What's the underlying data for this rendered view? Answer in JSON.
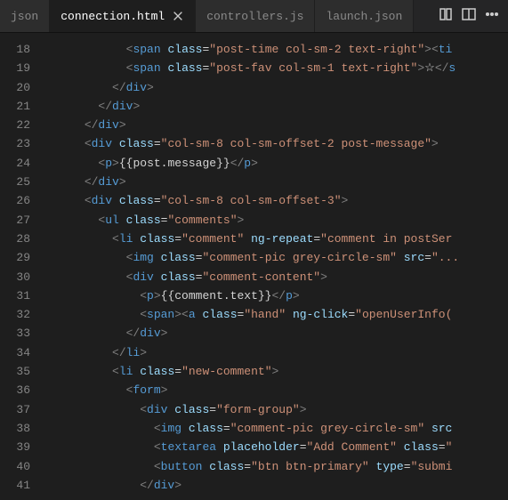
{
  "tabs": {
    "t0": "json",
    "t1": "connection.html",
    "t2": "controllers.js",
    "t3": "launch.json"
  },
  "gutter": [
    "18",
    "19",
    "20",
    "21",
    "22",
    "23",
    "24",
    "25",
    "26",
    "27",
    "28",
    "29",
    "30",
    "31",
    "32",
    "33",
    "34",
    "35",
    "36",
    "37",
    "38",
    "39",
    "40",
    "41"
  ],
  "code": {
    "l18": [
      {
        "c": "t-txt",
        "t": "            "
      },
      {
        "c": "t-brk",
        "t": "<"
      },
      {
        "c": "t-tag",
        "t": "span"
      },
      {
        "c": "t-txt",
        "t": " "
      },
      {
        "c": "t-attr",
        "t": "class"
      },
      {
        "c": "t-txt",
        "t": "="
      },
      {
        "c": "t-str",
        "t": "\"post-time col-sm-2 text-right\""
      },
      {
        "c": "t-brk",
        "t": "><"
      },
      {
        "c": "t-tag",
        "t": "ti"
      }
    ],
    "l19": [
      {
        "c": "t-txt",
        "t": "            "
      },
      {
        "c": "t-brk",
        "t": "<"
      },
      {
        "c": "t-tag",
        "t": "span"
      },
      {
        "c": "t-txt",
        "t": " "
      },
      {
        "c": "t-attr",
        "t": "class"
      },
      {
        "c": "t-txt",
        "t": "="
      },
      {
        "c": "t-str",
        "t": "\"post-fav col-sm-1 text-right\""
      },
      {
        "c": "t-brk",
        "t": ">"
      },
      {
        "c": "t-txt",
        "t": "☆"
      },
      {
        "c": "t-brk",
        "t": "</"
      },
      {
        "c": "t-tag",
        "t": "s"
      }
    ],
    "l20": [
      {
        "c": "t-txt",
        "t": "          "
      },
      {
        "c": "t-brk",
        "t": "</"
      },
      {
        "c": "t-tag",
        "t": "div"
      },
      {
        "c": "t-brk",
        "t": ">"
      }
    ],
    "l21": [
      {
        "c": "t-txt",
        "t": "        "
      },
      {
        "c": "t-brk",
        "t": "</"
      },
      {
        "c": "t-tag",
        "t": "div"
      },
      {
        "c": "t-brk",
        "t": ">"
      }
    ],
    "l22": [
      {
        "c": "t-txt",
        "t": "      "
      },
      {
        "c": "t-brk",
        "t": "</"
      },
      {
        "c": "t-tag",
        "t": "div"
      },
      {
        "c": "t-brk",
        "t": ">"
      }
    ],
    "l23": [
      {
        "c": "t-txt",
        "t": "      "
      },
      {
        "c": "t-brk",
        "t": "<"
      },
      {
        "c": "t-tag",
        "t": "div"
      },
      {
        "c": "t-txt",
        "t": " "
      },
      {
        "c": "t-attr",
        "t": "class"
      },
      {
        "c": "t-txt",
        "t": "="
      },
      {
        "c": "t-str",
        "t": "\"col-sm-8 col-sm-offset-2 post-message\""
      },
      {
        "c": "t-brk",
        "t": ">"
      }
    ],
    "l24": [
      {
        "c": "t-txt",
        "t": "        "
      },
      {
        "c": "t-brk",
        "t": "<"
      },
      {
        "c": "t-tag",
        "t": "p"
      },
      {
        "c": "t-brk",
        "t": ">"
      },
      {
        "c": "t-txt",
        "t": "{{post.message}}"
      },
      {
        "c": "t-brk",
        "t": "</"
      },
      {
        "c": "t-tag",
        "t": "p"
      },
      {
        "c": "t-brk",
        "t": ">"
      }
    ],
    "l25": [
      {
        "c": "t-txt",
        "t": "      "
      },
      {
        "c": "t-brk",
        "t": "</"
      },
      {
        "c": "t-tag",
        "t": "div"
      },
      {
        "c": "t-brk",
        "t": ">"
      }
    ],
    "l26": [
      {
        "c": "t-txt",
        "t": "      "
      },
      {
        "c": "t-brk",
        "t": "<"
      },
      {
        "c": "t-tag",
        "t": "div"
      },
      {
        "c": "t-txt",
        "t": " "
      },
      {
        "c": "t-attr",
        "t": "class"
      },
      {
        "c": "t-txt",
        "t": "="
      },
      {
        "c": "t-str",
        "t": "\"col-sm-8 col-sm-offset-3\""
      },
      {
        "c": "t-brk",
        "t": ">"
      }
    ],
    "l27": [
      {
        "c": "t-txt",
        "t": "        "
      },
      {
        "c": "t-brk",
        "t": "<"
      },
      {
        "c": "t-tag",
        "t": "ul"
      },
      {
        "c": "t-txt",
        "t": " "
      },
      {
        "c": "t-attr",
        "t": "class"
      },
      {
        "c": "t-txt",
        "t": "="
      },
      {
        "c": "t-str",
        "t": "\"comments\""
      },
      {
        "c": "t-brk",
        "t": ">"
      }
    ],
    "l28": [
      {
        "c": "t-txt",
        "t": "          "
      },
      {
        "c": "t-brk",
        "t": "<"
      },
      {
        "c": "t-tag",
        "t": "li"
      },
      {
        "c": "t-txt",
        "t": " "
      },
      {
        "c": "t-attr",
        "t": "class"
      },
      {
        "c": "t-txt",
        "t": "="
      },
      {
        "c": "t-str",
        "t": "\"comment\""
      },
      {
        "c": "t-txt",
        "t": " "
      },
      {
        "c": "t-attr",
        "t": "ng-repeat"
      },
      {
        "c": "t-txt",
        "t": "="
      },
      {
        "c": "t-str",
        "t": "\"comment in postSer"
      }
    ],
    "l29": [
      {
        "c": "t-txt",
        "t": "            "
      },
      {
        "c": "t-brk",
        "t": "<"
      },
      {
        "c": "t-tag",
        "t": "img"
      },
      {
        "c": "t-txt",
        "t": " "
      },
      {
        "c": "t-attr",
        "t": "class"
      },
      {
        "c": "t-txt",
        "t": "="
      },
      {
        "c": "t-str",
        "t": "\"comment-pic grey-circle-sm\""
      },
      {
        "c": "t-txt",
        "t": " "
      },
      {
        "c": "t-attr",
        "t": "src"
      },
      {
        "c": "t-txt",
        "t": "="
      },
      {
        "c": "t-str",
        "t": "\"..."
      }
    ],
    "l30": [
      {
        "c": "t-txt",
        "t": "            "
      },
      {
        "c": "t-brk",
        "t": "<"
      },
      {
        "c": "t-tag",
        "t": "div"
      },
      {
        "c": "t-txt",
        "t": " "
      },
      {
        "c": "t-attr",
        "t": "class"
      },
      {
        "c": "t-txt",
        "t": "="
      },
      {
        "c": "t-str",
        "t": "\"comment-content\""
      },
      {
        "c": "t-brk",
        "t": ">"
      }
    ],
    "l31": [
      {
        "c": "t-txt",
        "t": "              "
      },
      {
        "c": "t-brk",
        "t": "<"
      },
      {
        "c": "t-tag",
        "t": "p"
      },
      {
        "c": "t-brk",
        "t": ">"
      },
      {
        "c": "t-txt",
        "t": "{{comment.text}}"
      },
      {
        "c": "t-brk",
        "t": "</"
      },
      {
        "c": "t-tag",
        "t": "p"
      },
      {
        "c": "t-brk",
        "t": ">"
      }
    ],
    "l32": [
      {
        "c": "t-txt",
        "t": "              "
      },
      {
        "c": "t-brk",
        "t": "<"
      },
      {
        "c": "t-tag",
        "t": "span"
      },
      {
        "c": "t-brk",
        "t": "><"
      },
      {
        "c": "t-tag",
        "t": "a"
      },
      {
        "c": "t-txt",
        "t": " "
      },
      {
        "c": "t-attr",
        "t": "class"
      },
      {
        "c": "t-txt",
        "t": "="
      },
      {
        "c": "t-str",
        "t": "\"hand\""
      },
      {
        "c": "t-txt",
        "t": " "
      },
      {
        "c": "t-attr",
        "t": "ng-click"
      },
      {
        "c": "t-txt",
        "t": "="
      },
      {
        "c": "t-str",
        "t": "\"openUserInfo("
      }
    ],
    "l33": [
      {
        "c": "t-txt",
        "t": "            "
      },
      {
        "c": "t-brk",
        "t": "</"
      },
      {
        "c": "t-tag",
        "t": "div"
      },
      {
        "c": "t-brk",
        "t": ">"
      }
    ],
    "l34": [
      {
        "c": "t-txt",
        "t": "          "
      },
      {
        "c": "t-brk",
        "t": "</"
      },
      {
        "c": "t-tag",
        "t": "li"
      },
      {
        "c": "t-brk",
        "t": ">"
      }
    ],
    "l35": [
      {
        "c": "t-txt",
        "t": "          "
      },
      {
        "c": "t-brk",
        "t": "<"
      },
      {
        "c": "t-tag",
        "t": "li"
      },
      {
        "c": "t-txt",
        "t": " "
      },
      {
        "c": "t-attr",
        "t": "class"
      },
      {
        "c": "t-txt",
        "t": "="
      },
      {
        "c": "t-str",
        "t": "\"new-comment\""
      },
      {
        "c": "t-brk",
        "t": ">"
      }
    ],
    "l36": [
      {
        "c": "t-txt",
        "t": "            "
      },
      {
        "c": "t-brk",
        "t": "<"
      },
      {
        "c": "t-tag",
        "t": "form"
      },
      {
        "c": "t-brk",
        "t": ">"
      }
    ],
    "l37": [
      {
        "c": "t-txt",
        "t": "              "
      },
      {
        "c": "t-brk",
        "t": "<"
      },
      {
        "c": "t-tag",
        "t": "div"
      },
      {
        "c": "t-txt",
        "t": " "
      },
      {
        "c": "t-attr",
        "t": "class"
      },
      {
        "c": "t-txt",
        "t": "="
      },
      {
        "c": "t-str",
        "t": "\"form-group\""
      },
      {
        "c": "t-brk",
        "t": ">"
      }
    ],
    "l38": [
      {
        "c": "t-txt",
        "t": "                "
      },
      {
        "c": "t-brk",
        "t": "<"
      },
      {
        "c": "t-tag",
        "t": "img"
      },
      {
        "c": "t-txt",
        "t": " "
      },
      {
        "c": "t-attr",
        "t": "class"
      },
      {
        "c": "t-txt",
        "t": "="
      },
      {
        "c": "t-str",
        "t": "\"comment-pic grey-circle-sm\""
      },
      {
        "c": "t-txt",
        "t": " "
      },
      {
        "c": "t-attr",
        "t": "src"
      }
    ],
    "l39": [
      {
        "c": "t-txt",
        "t": "                "
      },
      {
        "c": "t-brk",
        "t": "<"
      },
      {
        "c": "t-tag",
        "t": "textarea"
      },
      {
        "c": "t-txt",
        "t": " "
      },
      {
        "c": "t-attr",
        "t": "placeholder"
      },
      {
        "c": "t-txt",
        "t": "="
      },
      {
        "c": "t-str",
        "t": "\"Add Comment\""
      },
      {
        "c": "t-txt",
        "t": " "
      },
      {
        "c": "t-attr",
        "t": "class"
      },
      {
        "c": "t-txt",
        "t": "="
      },
      {
        "c": "t-str",
        "t": "\""
      }
    ],
    "l40": [
      {
        "c": "t-txt",
        "t": "                "
      },
      {
        "c": "t-brk",
        "t": "<"
      },
      {
        "c": "t-tag",
        "t": "button"
      },
      {
        "c": "t-txt",
        "t": " "
      },
      {
        "c": "t-attr",
        "t": "class"
      },
      {
        "c": "t-txt",
        "t": "="
      },
      {
        "c": "t-str",
        "t": "\"btn btn-primary\""
      },
      {
        "c": "t-txt",
        "t": " "
      },
      {
        "c": "t-attr",
        "t": "type"
      },
      {
        "c": "t-txt",
        "t": "="
      },
      {
        "c": "t-str",
        "t": "\"submi"
      }
    ],
    "l41": [
      {
        "c": "t-txt",
        "t": "              "
      },
      {
        "c": "t-brk",
        "t": "</"
      },
      {
        "c": "t-tag",
        "t": "div"
      },
      {
        "c": "t-brk",
        "t": ">"
      }
    ]
  }
}
